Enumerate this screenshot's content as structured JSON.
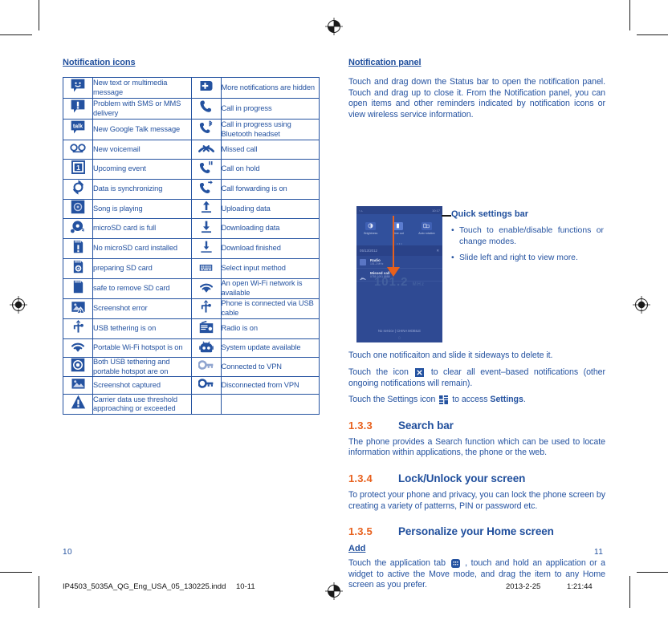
{
  "colors": {
    "blue_text": "#2452a0",
    "heading_blue": "#1f4e9c",
    "accent_orange": "#e8601c",
    "phone_bg": "#2f4a93"
  },
  "left_column": {
    "heading": "Notification icons",
    "table": {
      "rows": [
        {
          "left": {
            "icon": "message-smiley-icon",
            "label": "New text or multimedia message"
          },
          "right": {
            "icon": "more-notifications-icon",
            "label": "More notifications are hidden"
          }
        },
        {
          "left": {
            "icon": "message-problem-icon",
            "label": "Problem with SMS or MMS delivery"
          },
          "right": {
            "icon": "call-in-progress-icon",
            "label": "Call in progress"
          }
        },
        {
          "left": {
            "icon": "google-talk-icon",
            "label": "New Google Talk message"
          },
          "right": {
            "icon": "call-bluetooth-icon",
            "label": "Call in progress using Bluetooth headset"
          }
        },
        {
          "left": {
            "icon": "voicemail-icon",
            "label": "New voicemail"
          },
          "right": {
            "icon": "missed-call-icon",
            "label": "Missed call"
          }
        },
        {
          "left": {
            "icon": "calendar-event-icon",
            "label": "Upcoming event"
          },
          "right": {
            "icon": "call-on-hold-icon",
            "label": "Call on hold"
          }
        },
        {
          "left": {
            "icon": "sync-icon",
            "label": "Data is synchronizing"
          },
          "right": {
            "icon": "call-forwarding-icon",
            "label": "Call forwarding is on"
          }
        },
        {
          "left": {
            "icon": "music-playing-icon",
            "label": "Song is playing"
          },
          "right": {
            "icon": "upload-icon",
            "label": "Uploading data"
          }
        },
        {
          "left": {
            "icon": "sdcard-full-icon",
            "label": "microSD card is full"
          },
          "right": {
            "icon": "download-icon",
            "label": "Downloading data"
          }
        },
        {
          "left": {
            "icon": "no-sdcard-icon",
            "label": "No microSD card installed"
          },
          "right": {
            "icon": "download-finished-icon",
            "label": "Download finished"
          }
        },
        {
          "left": {
            "icon": "preparing-sdcard-icon",
            "label": "preparing SD card"
          },
          "right": {
            "icon": "keyboard-icon",
            "label": "Select input method"
          }
        },
        {
          "left": {
            "icon": "safe-remove-sdcard-icon",
            "label": "safe to remove SD card"
          },
          "right": {
            "icon": "wifi-open-icon",
            "label": "An open Wi-Fi network is available"
          }
        },
        {
          "left": {
            "icon": "screenshot-error-icon",
            "label": "Screenshot error"
          },
          "right": {
            "icon": "usb-connected-icon",
            "label": "Phone is connected via USB cable"
          }
        },
        {
          "left": {
            "icon": "usb-tethering-icon",
            "label": "USB tethering is on"
          },
          "right": {
            "icon": "radio-icon",
            "label": "Radio is on"
          }
        },
        {
          "left": {
            "icon": "wifi-hotspot-icon",
            "label": "Portable Wi-Fi hotspot is on"
          },
          "right": {
            "icon": "system-update-icon",
            "label": "System update available"
          }
        },
        {
          "left": {
            "icon": "tethering-both-icon",
            "label": "Both USB tethering and portable hotspot are on"
          },
          "right": {
            "icon": "vpn-connected-icon",
            "label": "Connected to VPN"
          }
        },
        {
          "left": {
            "icon": "screenshot-captured-icon",
            "label": "Screenshot captured"
          },
          "right": {
            "icon": "vpn-disconnected-icon",
            "label": "Disconnected from VPN"
          }
        },
        {
          "left": {
            "icon": "data-warning-icon",
            "label": "Carrier data use threshold approaching or exceeded"
          },
          "right": {
            "icon": "",
            "label": ""
          }
        }
      ]
    }
  },
  "right_column": {
    "notification_panel": {
      "heading": "Notification panel",
      "paragraph": "Touch and drag down the Status bar to open the notification panel. Touch and drag up to close it. From the Notification panel, you can open items and other reminders indicated by notification icons or view wireless service information."
    },
    "phone_screenshot": {
      "status_time": "10:17",
      "quick_settings": [
        {
          "icon": "brightness-icon",
          "label": "Brightness"
        },
        {
          "icon": "timeout-icon",
          "label": "Time out"
        },
        {
          "icon": "auto-rotation-icon",
          "label": "Auto rotation"
        }
      ],
      "page_dots": "• • •",
      "date": "05/13/2012",
      "clear_label": "✕",
      "notifications": [
        {
          "icon": "radio-icon",
          "title": "Radio",
          "subtitle": "101.2 MHz"
        },
        {
          "icon": "missed-call-icon",
          "title": "Missed call",
          "subtitle": "0755 1091 8888"
        }
      ],
      "ghost_text": "101.2",
      "ghost_unit": "MHz",
      "footer_left": "No service",
      "footer_right": "CHINA MOBILE"
    },
    "callout": {
      "title": "Quick settings bar",
      "bullets": [
        "Touch to enable/disable functions or change modes.",
        "Slide left and right to view more."
      ]
    },
    "paragraphs": {
      "delete_notification": "Touch one notificaiton and slide it sideways to delete it.",
      "clear_all_part1": "Touch the icon",
      "clear_all_part2": "to clear all event–based notifications (other ongoing notifications will remain).",
      "settings_part1": "Touch the Settings icon",
      "settings_part2": "to access",
      "settings_bold": "Settings",
      "settings_period": "."
    },
    "sections": [
      {
        "number": "1.3.3",
        "title": "Search bar",
        "body": "The phone provides a Search function which can be used to locate information within applications, the phone or the web."
      },
      {
        "number": "1.3.4",
        "title": "Lock/Unlock your screen",
        "body": "To protect your phone and privacy, you can lock the phone screen by creating a variety of patterns, PIN or password etc."
      },
      {
        "number": "1.3.5",
        "title": "Personalize your Home screen",
        "subheading": "Add",
        "body_part1": "Touch the application tab",
        "body_part2": ", touch and hold an application or a widget to active the Move mode, and drag the item to any Home screen as you prefer."
      }
    ]
  },
  "page_numbers": {
    "left": "10",
    "right": "11"
  },
  "print_footer": {
    "filename": "IP4503_5035A_QG_Eng_USA_05_130225.indd",
    "pages": "10-11",
    "date": "2013-2-25",
    "time": "1:21:44"
  }
}
